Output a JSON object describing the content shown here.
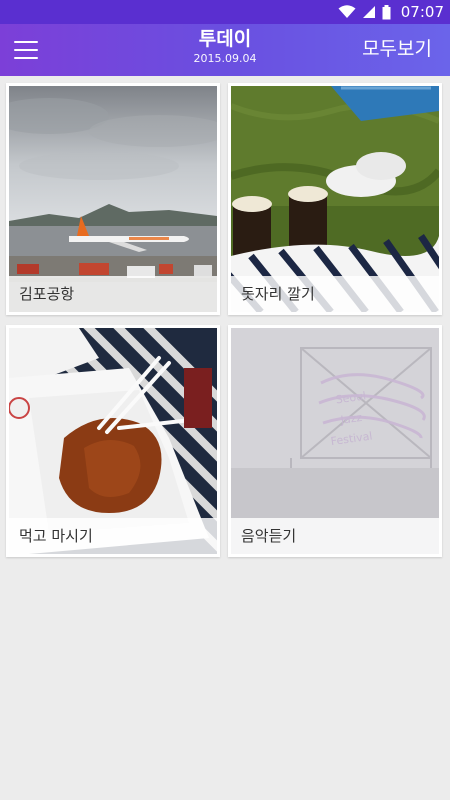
{
  "status": {
    "time": "07:07"
  },
  "header": {
    "title": "투데이",
    "date": "2015.09.04",
    "view_all_label": "모두보기",
    "menu_icon": "hamburger-menu-icon"
  },
  "cards": [
    {
      "caption": "김포공항"
    },
    {
      "caption": "돗자리 깔기"
    },
    {
      "caption": "먹고 마시기"
    },
    {
      "caption": "음악듣기"
    }
  ],
  "colors": {
    "status_bar": "#5a2fd0",
    "app_bar_start": "#7c3fd8",
    "app_bar_end": "#6b64ea",
    "background": "#ececec"
  }
}
